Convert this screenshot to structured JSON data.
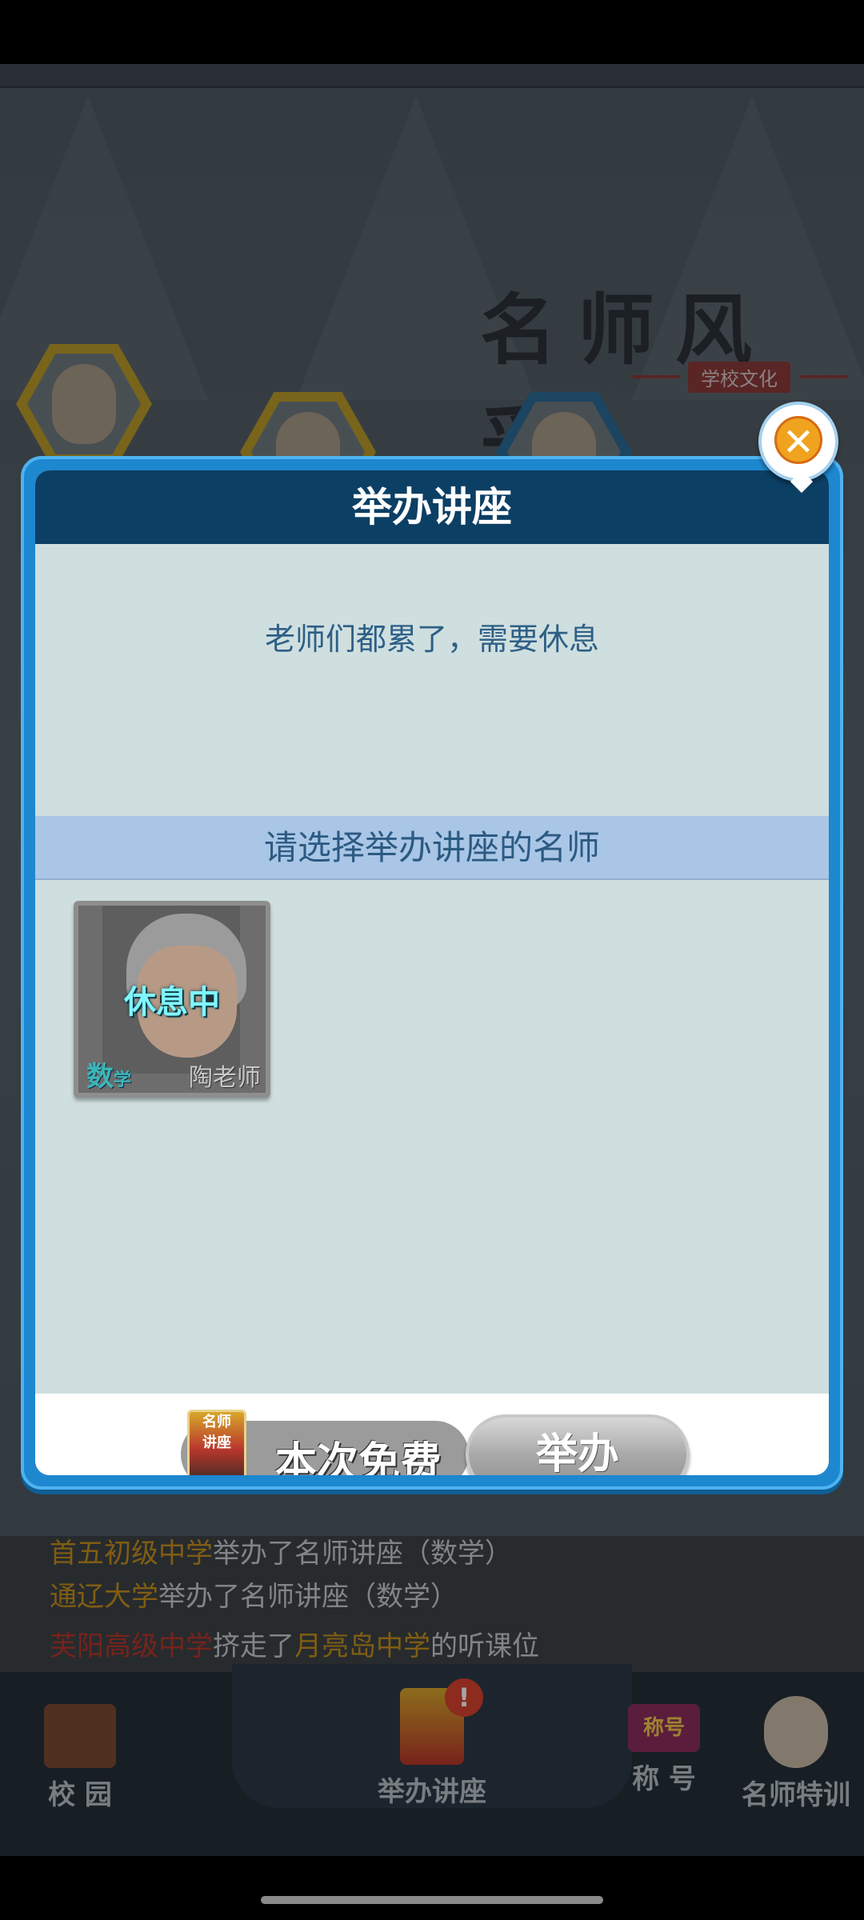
{
  "background": {
    "title": "名师风采",
    "subtitle": "学校文化",
    "news_feed": [
      {
        "segments": [
          {
            "text": "首五初级中学",
            "color": "yellow"
          },
          {
            "text": "举办了名师讲座（数学）",
            "color": "white"
          }
        ]
      },
      {
        "segments": [
          {
            "text": "通辽大学",
            "color": "yellow"
          },
          {
            "text": "举办了名师讲座（数学）",
            "color": "white"
          }
        ]
      },
      {
        "segments": [
          {
            "text": "芙阳高级中学",
            "color": "red"
          },
          {
            "text": "挤走了",
            "color": "white"
          },
          {
            "text": "月亮岛中学",
            "color": "yellow"
          },
          {
            "text": "的听课位",
            "color": "white"
          }
        ]
      }
    ]
  },
  "dialog": {
    "title": "举办讲座",
    "message": "老师们都累了，需要休息",
    "section_title": "请选择举办讲座的名师",
    "teacher": {
      "status": "休息中",
      "subject_main": "数",
      "subject_small": "学",
      "name": "陶老师"
    },
    "cost_icon_text": [
      "名师",
      "讲座"
    ],
    "cost_text": "本次免费",
    "hold_button": "举办",
    "close_symbol": "✕"
  },
  "bottom_nav": {
    "items": [
      {
        "label": "校 园"
      },
      {
        "label": "举办讲座"
      },
      {
        "label": "称 号"
      },
      {
        "label": "名师特训"
      }
    ],
    "badge": "!",
    "title_icon_text": "称号"
  },
  "colors": {
    "dialog_frame": "#1d87cf",
    "dialog_header": "#0c3f64",
    "dialog_body": "#cfdfdf",
    "section_bar": "#a9c6e6",
    "feed_yellow": "#c7901c",
    "feed_red": "#b5372a"
  }
}
